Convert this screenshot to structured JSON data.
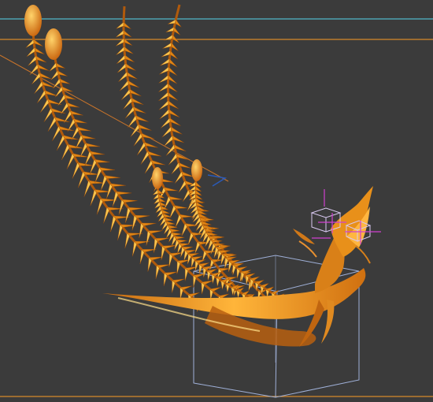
{
  "viewport": {
    "background_color": "#3b3b3b",
    "subject": "golden-phoenix-model",
    "colors": {
      "feather_light": "#f7c24a",
      "feather_mid": "#e88a12",
      "feather_dark": "#a8480a",
      "guide_cyan": "#4fb6c8",
      "guide_orange": "#d78a2a",
      "bounding_box": "#9fb0d8",
      "bone_handle": "#d040d0"
    },
    "overlays": [
      "top-cyan-guide-line",
      "top-orange-guide-line",
      "bottom-orange-guide-line",
      "diagonal-orange-guide-line",
      "selection-bounding-box",
      "head-control-cubes",
      "bone-cross-handles"
    ]
  }
}
